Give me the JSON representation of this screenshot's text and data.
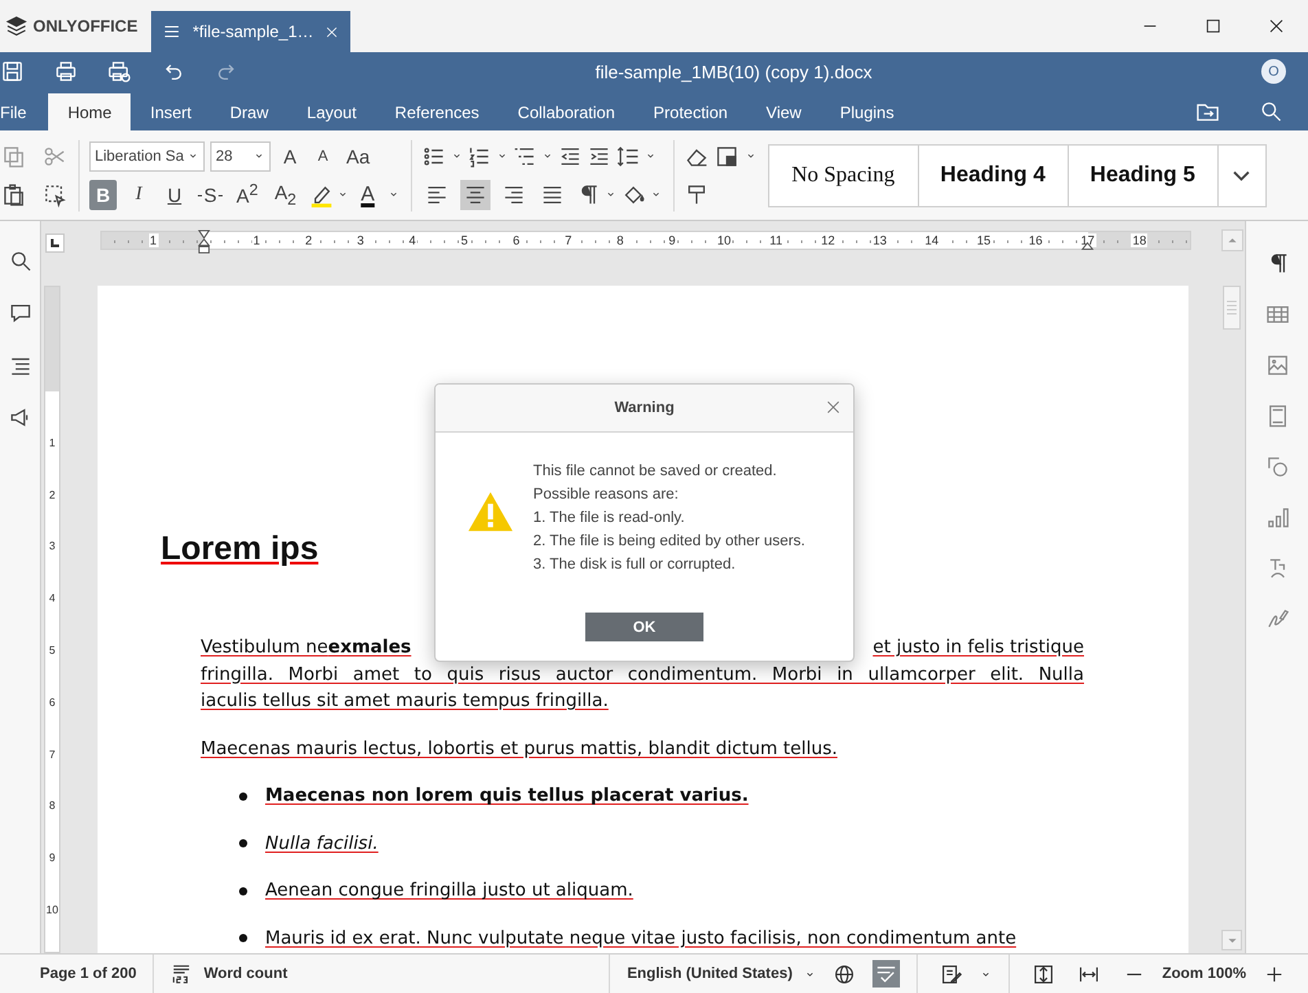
{
  "app": {
    "name": "ONLYOFFICE"
  },
  "tabs": [
    {
      "label": "*file-sample_1…",
      "selected": true
    }
  ],
  "document_title": "file-sample_1MB(10) (copy 1).docx",
  "user_avatar": "O",
  "menu": [
    {
      "label": "File",
      "selected": false
    },
    {
      "label": "Home",
      "selected": true
    },
    {
      "label": "Insert",
      "selected": false
    },
    {
      "label": "Draw",
      "selected": false
    },
    {
      "label": "Layout",
      "selected": false
    },
    {
      "label": "References",
      "selected": false
    },
    {
      "label": "Collaboration",
      "selected": false
    },
    {
      "label": "Protection",
      "selected": false
    },
    {
      "label": "View",
      "selected": false
    },
    {
      "label": "Plugins",
      "selected": false
    }
  ],
  "toolbar": {
    "font_name": "Liberation Sa",
    "font_size": "28",
    "font_buttons": [
      "A",
      "A",
      "Aa"
    ],
    "format_buttons": [
      {
        "glyph": "B",
        "selected": true
      },
      {
        "glyph": "I",
        "selected": false
      },
      {
        "glyph": "U",
        "selected": false
      },
      {
        "glyph": "S",
        "selected": false
      },
      {
        "glyph": "A$^{2}$",
        "selected": false
      },
      {
        "glyph": "A$_{2}$",
        "selected": false
      }
    ],
    "font_color_glyph": "A",
    "align_buttons": [
      {
        "selected": false
      },
      {
        "selected": true
      },
      {
        "selected": false
      },
      {
        "selected": false
      }
    ],
    "styles": [
      "No Spacing",
      "Heading 4",
      "Heading 5"
    ]
  },
  "ruler": {
    "horizontal_labels": [
      "1",
      "1",
      "2",
      "3",
      "4",
      "5",
      "6",
      "7",
      "8",
      "9",
      "10",
      "11",
      "12",
      "13",
      "14",
      "15",
      "16",
      "17",
      "18"
    ],
    "vertical_labels": [
      "1",
      "2",
      "3",
      "4",
      "5",
      "6",
      "7",
      "8",
      "9",
      "10"
    ]
  },
  "document": {
    "heading": "Lorem ips",
    "paragraph_1": {
      "line_1_left": "Vestibulum ne**exmales**",
      "line_1_right": "et justo in felis tristique",
      "lines": [
        "fringilla. Morbi amet to quis risus auctor condimentum. Morbi in ullamcorper elit. Nulla",
        "iaculis tellus sit amet mauris tempus fringilla."
      ]
    },
    "paragraph_2": "Maecenas mauris lectus, lobortis et purus mattis, blandit dictum tellus.",
    "list": [
      {
        "kind": "bold",
        "text": "Maecenas non lorem quis tellus placerat varius."
      },
      {
        "kind": "italic",
        "text": "Nulla facilisi."
      },
      {
        "kind": "plain",
        "text": "Aenean congue fringilla justo ut aliquam."
      },
      {
        "kind": "plain",
        "text": "Mauris id ex erat. Nunc vulputate neque vitae justo facilisis, non condimentum ante"
      }
    ]
  },
  "dialog": {
    "title": "Warning",
    "lines": [
      "This file cannot be saved or created.",
      "Possible reasons are:",
      "1. The file is read-only.",
      "2. The file is being edited by other users.",
      "3. The disk is full or corrupted."
    ],
    "button": "OK"
  },
  "status_bar": {
    "page": "Page 1 of 200",
    "word_count": "Word count",
    "language": "English (United States)",
    "spellcheck_on": true,
    "zoom": "Zoom 100%"
  }
}
